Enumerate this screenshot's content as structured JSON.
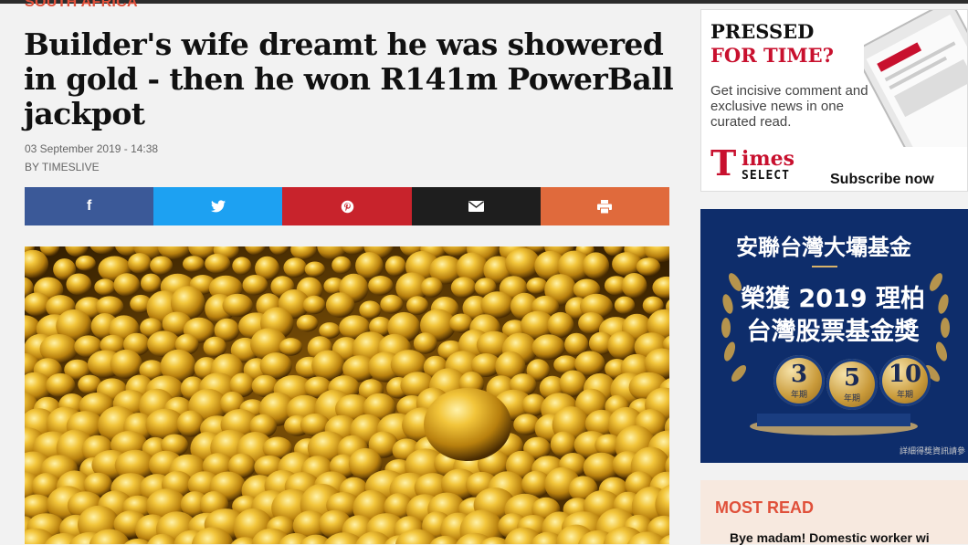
{
  "article": {
    "section": "SOUTH AFRICA",
    "headline": "Builder's wife dreamt he was showered in gold - then he won R141m PowerBall jackpot",
    "date": "03 September 2019 - 14:38",
    "byline": "BY TIMESLIVE"
  },
  "share": {
    "buttons": [
      {
        "icon": "facebook-icon",
        "glyph": "f"
      },
      {
        "icon": "twitter-icon",
        "glyph": ""
      },
      {
        "icon": "pinterest-icon",
        "glyph": ""
      },
      {
        "icon": "mail-icon",
        "glyph": ""
      },
      {
        "icon": "print-icon",
        "glyph": ""
      }
    ],
    "colors": {
      "facebook": "#3b5998",
      "twitter": "#1da1f2",
      "pinterest": "#c8232c",
      "mail": "#1e1e1e",
      "print": "#e06a3c"
    }
  },
  "ad_times": {
    "line1": "PRESSED",
    "line2": "FOR TIME?",
    "description": "Get incisive comment and exclusive news in one curated read.",
    "logo_initial": "T",
    "logo_rest": "imes",
    "logo_select": "SELECT",
    "cta": "Subscribe now"
  },
  "ad_fund": {
    "title": "安聯台灣大壩基金",
    "award_line1": "榮獲 2019 理柏",
    "award_line2": "台灣股票基金獎",
    "medals": [
      {
        "num": "3",
        "unit": "年期"
      },
      {
        "num": "5",
        "unit": "年期"
      },
      {
        "num": "10",
        "unit": "年期"
      }
    ],
    "fine_print": "詳細得獎資訊請參"
  },
  "most_read": {
    "heading": "MOST READ",
    "first_item": "Bye madam! Domestic worker wi"
  }
}
